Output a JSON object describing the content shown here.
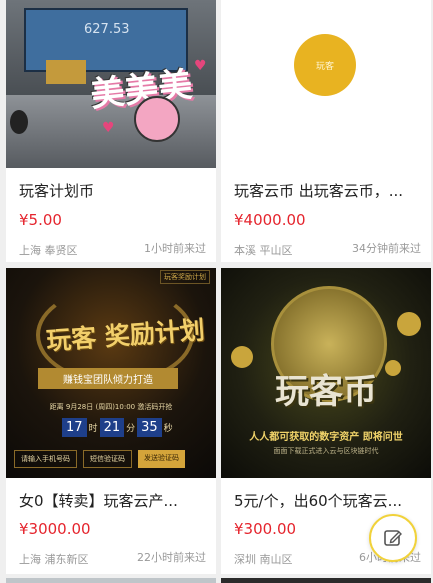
{
  "cards": [
    {
      "title": "玩客计划币",
      "price": "¥5.00",
      "location": "上海 奉贤区",
      "time": "1小时前来过",
      "image": {
        "screen_value": "627.53",
        "sticker_text": "美美美"
      }
    },
    {
      "title": "玩客云币 出玩客云币，...",
      "price": "¥4000.00",
      "location": "本溪 平山区",
      "time": "34分钟前来过",
      "image": {
        "coin_text": "玩客"
      }
    },
    {
      "title": "女0【转卖】玩客云产...",
      "price": "¥3000.00",
      "location": "上海 浦东新区",
      "time": "22小时前来过",
      "image": {
        "corner_tag": "玩客奖励计划",
        "headline": "玩客 奖励计划",
        "ribbon": "赚钱宝团队倾力打造",
        "date_line": "距离 9月28日 (周四)10:00 激活码开抢",
        "countdown": [
          "17",
          "21",
          "35"
        ],
        "countdown_units": [
          "时",
          "分",
          "秒"
        ],
        "buttons": [
          "请输入手机号码",
          "短信验证码",
          "发送验证码"
        ]
      }
    },
    {
      "title": "5元/个，出60个玩客云...",
      "price": "¥300.00",
      "location": "深圳 南山区",
      "time": "6小时前来过",
      "image": {
        "headline": "玩客币",
        "slogan": "人人都可获取的数字资产 即将问世",
        "subline": "面面下载正式进入云与区块链时代"
      }
    }
  ],
  "fab": {
    "icon": "edit-icon"
  },
  "colors": {
    "price": "#e5252e",
    "accent": "#f1d23a"
  }
}
